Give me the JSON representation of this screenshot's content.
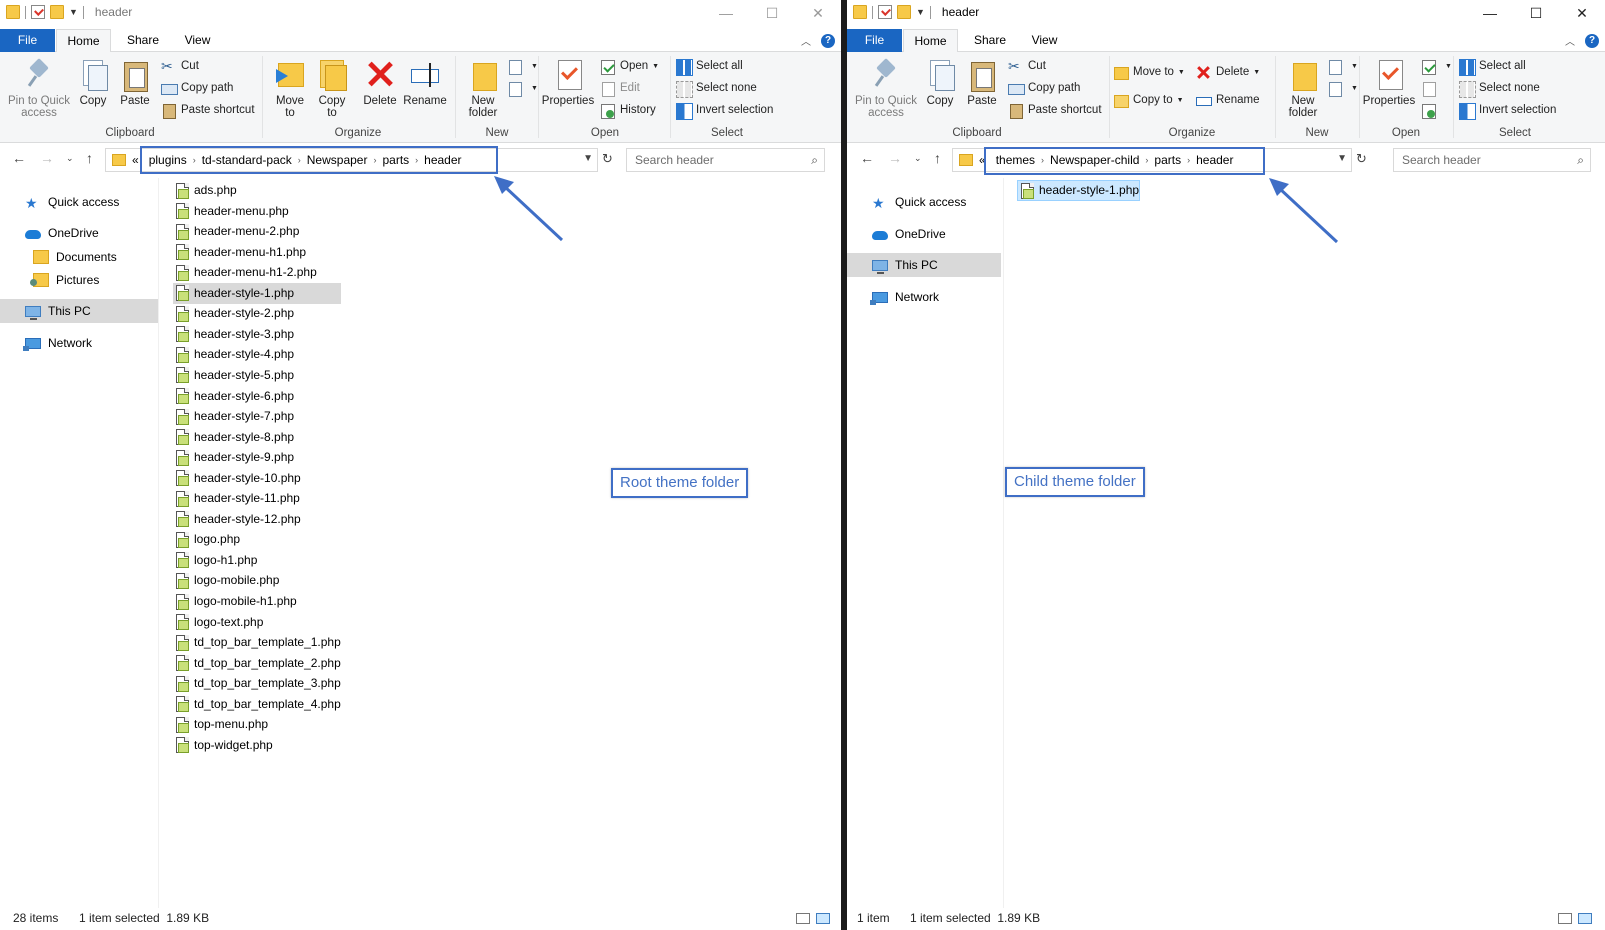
{
  "left": {
    "title": "header",
    "tabs": {
      "file": "File",
      "home": "Home",
      "share": "Share",
      "view": "View"
    },
    "ribbon": {
      "clipboard": {
        "label": "Clipboard",
        "pin": "Pin to Quick access",
        "copy": "Copy",
        "paste": "Paste",
        "cut": "Cut",
        "copy_path": "Copy path",
        "paste_shortcut": "Paste shortcut"
      },
      "organize": {
        "label": "Organize",
        "move_to": "Move to",
        "copy_to": "Copy to",
        "delete": "Delete",
        "rename": "Rename"
      },
      "new": {
        "label": "New",
        "new_folder": "New folder"
      },
      "open": {
        "label": "Open",
        "properties": "Properties",
        "open": "Open",
        "edit": "Edit",
        "history": "History"
      },
      "select": {
        "label": "Select",
        "select_all": "Select all",
        "select_none": "Select none",
        "invert": "Invert selection"
      }
    },
    "address": {
      "overflow": "«",
      "crumbs": [
        "plugins",
        "td-standard-pack",
        "Newspaper",
        "parts",
        "header"
      ]
    },
    "search_placeholder": "Search header",
    "nav": [
      {
        "label": "Quick access",
        "icon": "quick-access-star-icon"
      },
      {
        "label": "OneDrive",
        "icon": "onedrive-cloud-icon"
      },
      {
        "label": "Documents",
        "icon": "documents-folder-icon"
      },
      {
        "label": "Pictures",
        "icon": "pictures-folder-icon"
      },
      {
        "label": "This PC",
        "icon": "this-pc-icon",
        "selected": true
      },
      {
        "label": "Network",
        "icon": "network-icon"
      }
    ],
    "files": [
      "ads.php",
      "header-menu.php",
      "header-menu-2.php",
      "header-menu-h1.php",
      "header-menu-h1-2.php",
      "header-style-1.php",
      "header-style-2.php",
      "header-style-3.php",
      "header-style-4.php",
      "header-style-5.php",
      "header-style-6.php",
      "header-style-7.php",
      "header-style-8.php",
      "header-style-9.php",
      "header-style-10.php",
      "header-style-11.php",
      "header-style-12.php",
      "logo.php",
      "logo-h1.php",
      "logo-mobile.php",
      "logo-mobile-h1.php",
      "logo-text.php",
      "td_top_bar_template_1.php",
      "td_top_bar_template_2.php",
      "td_top_bar_template_3.php",
      "td_top_bar_template_4.php",
      "top-menu.php",
      "top-widget.php"
    ],
    "selected_file": "header-style-1.php",
    "annotation": "Root theme folder",
    "status": {
      "count": "28 items",
      "selection": "1 item selected  1.89 KB"
    }
  },
  "right": {
    "title": "header",
    "tabs": {
      "file": "File",
      "home": "Home",
      "share": "Share",
      "view": "View"
    },
    "ribbon": {
      "clipboard": {
        "label": "Clipboard",
        "pin": "Pin to Quick access",
        "copy": "Copy",
        "paste": "Paste",
        "cut": "Cut",
        "copy_path": "Copy path",
        "paste_shortcut": "Paste shortcut"
      },
      "organize": {
        "label": "Organize",
        "move_to": "Move to",
        "copy_to": "Copy to",
        "delete": "Delete",
        "rename": "Rename"
      },
      "new": {
        "label": "New",
        "new_folder": "New folder"
      },
      "open": {
        "label": "Open",
        "properties": "Properties"
      },
      "select": {
        "label": "Select",
        "select_all": "Select all",
        "select_none": "Select none",
        "invert": "Invert selection"
      }
    },
    "address": {
      "overflow": "«",
      "crumbs": [
        "themes",
        "Newspaper-child",
        "parts",
        "header"
      ]
    },
    "search_placeholder": "Search header",
    "nav": [
      {
        "label": "Quick access",
        "icon": "quick-access-star-icon"
      },
      {
        "label": "OneDrive",
        "icon": "onedrive-cloud-icon"
      },
      {
        "label": "This PC",
        "icon": "this-pc-icon",
        "selected": true
      },
      {
        "label": "Network",
        "icon": "network-icon"
      }
    ],
    "files": [
      "header-style-1.php"
    ],
    "selected_file": "header-style-1.php",
    "annotation": "Child theme folder",
    "status": {
      "count": "1 item",
      "selection": "1 item selected  1.89 KB"
    }
  },
  "colors": {
    "accent": "#1a66c2",
    "annotation": "#3f6ec6",
    "selection": "#cce8ff",
    "selection_gray": "#d9d9d9",
    "folder": "#f7c948"
  }
}
